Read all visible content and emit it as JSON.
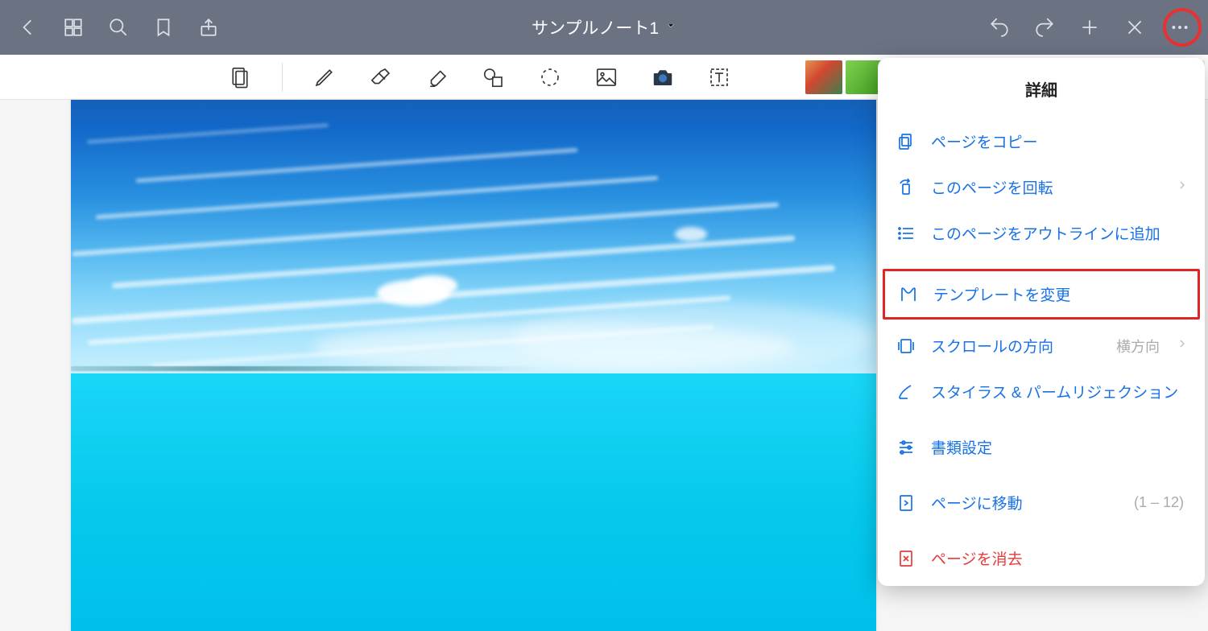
{
  "header": {
    "title": "サンプルノート1"
  },
  "popup": {
    "title": "詳細",
    "items": {
      "copy": {
        "label": "ページをコピー"
      },
      "rotate": {
        "label": "このページを回転"
      },
      "outline": {
        "label": "このページをアウトラインに追加"
      },
      "template": {
        "label": "テンプレートを変更"
      },
      "scroll": {
        "label": "スクロールの方向",
        "value": "横方向"
      },
      "stylus": {
        "label": "スタイラス & パームリジェクション"
      },
      "docset": {
        "label": "書類設定"
      },
      "goto": {
        "label": "ページに移動",
        "value": "(1 – 12)"
      },
      "clear": {
        "label": "ページを消去"
      }
    }
  }
}
